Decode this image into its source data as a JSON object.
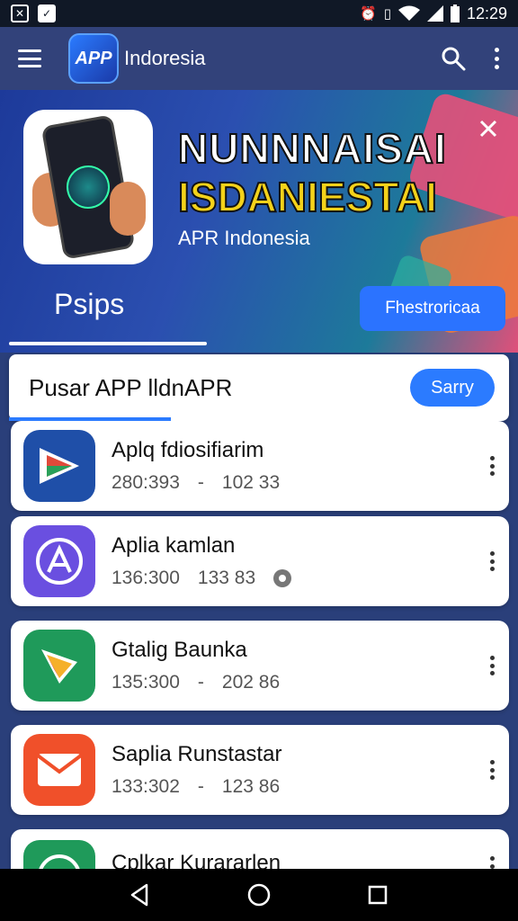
{
  "status_bar": {
    "time": "12:29",
    "left_icons": [
      "x-box-icon",
      "check-box-icon"
    ],
    "right_icons": [
      "alarm-icon",
      "vibrate-icon",
      "wifi-icon",
      "signal-icon",
      "battery-icon"
    ]
  },
  "app_bar": {
    "logo_text": "APP",
    "title": "Indoresia"
  },
  "hero": {
    "title_line1": "NUNNNAISAI",
    "title_line2": "ISDANIESTAI",
    "subtitle": "APR Indonesia",
    "tab_label": "Psips",
    "button_label": "Fhestroricaa",
    "colors": {
      "title1": "#ffffff",
      "title2": "#f4d21a",
      "button": "#2b73ff"
    }
  },
  "search": {
    "text": "Pusar APP lldnAPR",
    "button_label": "Sarry"
  },
  "apps": [
    {
      "name": "Aplq fdiosifiarim",
      "meta1": "280:393",
      "sep": "-",
      "meta2": "102 33",
      "icon": "play-triangle-icon",
      "icon_bg": "#1f4fa8"
    },
    {
      "name": "Aplia kamlan",
      "meta1": "136:300",
      "sep": "",
      "meta2": "133 83",
      "icon": "a-circle-icon",
      "icon_bg": "#6a4fe0",
      "badge": "settings-badge-icon"
    },
    {
      "name": "Gtalig Baunka",
      "meta1": "135:300",
      "sep": "-",
      "meta2": "202 86",
      "icon": "play-store-icon",
      "icon_bg": "#1f9a5a"
    },
    {
      "name": "Saplia Runstastar",
      "meta1": "133:302",
      "sep": "-",
      "meta2": "123 86",
      "icon": "mail-icon",
      "icon_bg": "#f0502a"
    },
    {
      "name": "Cplkar Kurararlen",
      "meta1": "",
      "sep": "",
      "meta2": "",
      "icon": "compass-icon",
      "icon_bg": "#1f9a5a"
    }
  ],
  "nav_bar": {
    "buttons": [
      "back-icon",
      "home-icon",
      "recents-icon"
    ]
  }
}
